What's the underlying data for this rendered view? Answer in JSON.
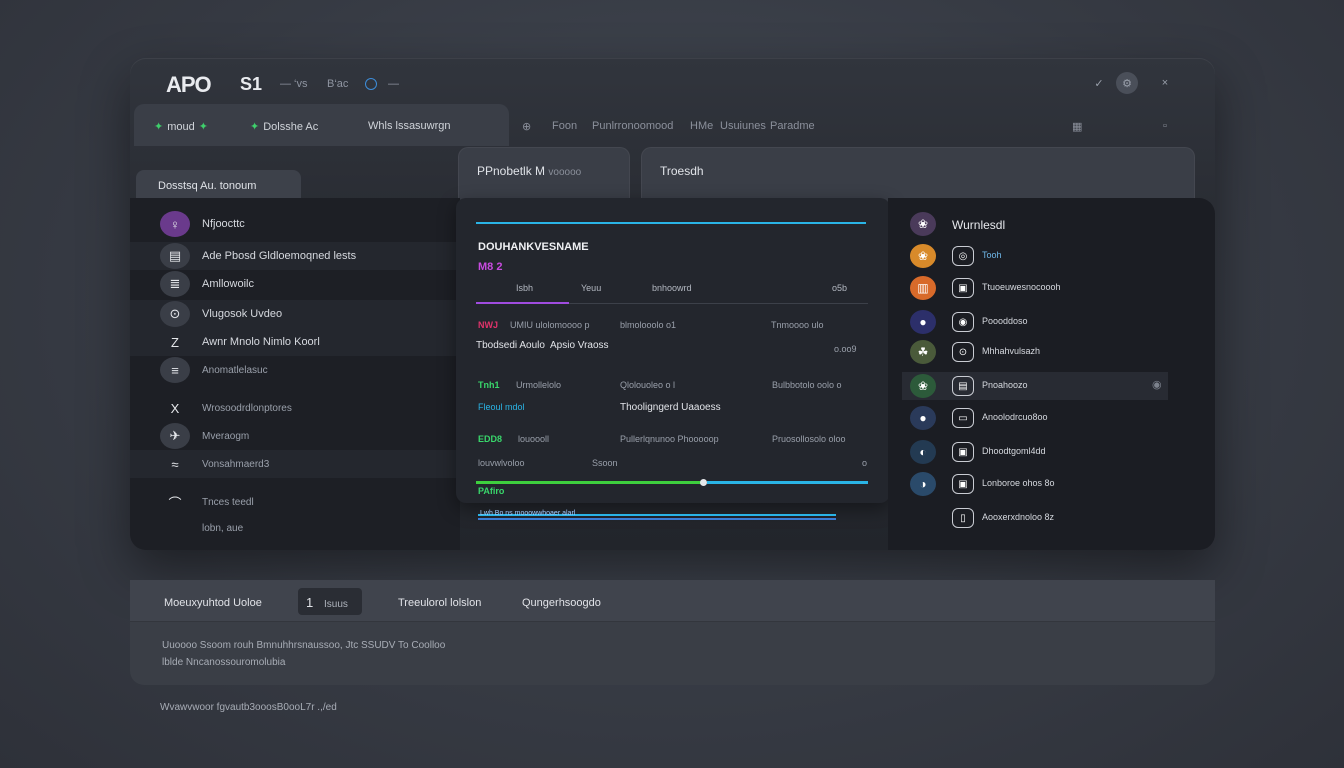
{
  "titlebar": {
    "logo": "APO",
    "app_title": "S1",
    "sub1": "— ‘vs",
    "sub2": "B‘ac",
    "sub3": "—"
  },
  "tabs": [
    {
      "label": "moud",
      "icon": "✦"
    },
    {
      "label": "Dolsshe Ac",
      "icon": "✦"
    },
    {
      "label": "Whls lssasuwrgn"
    }
  ],
  "toolbar": {
    "item1": "Foon",
    "item2": "Punlrronoomood",
    "item3": "HMe",
    "item4": "Usuiunes",
    "item5": "Paradme"
  },
  "tab_cards": {
    "card1": "PPnobetlk M",
    "card1_sub": "vooooo",
    "card2": "Troesdh"
  },
  "left_tab": "Dosstsq Au. tonoum",
  "left_items": [
    {
      "icon": "♀",
      "label": "Nfjoocttc"
    },
    {
      "icon": "▤",
      "label": "Ade Pbosd Gldloemoqned lests"
    },
    {
      "icon": "≣",
      "label": "Amllowoilc"
    },
    {
      "icon": "⊙",
      "label": "Vlugosok Uvdeo"
    },
    {
      "icon": "Z",
      "label": "Awnr Mnolo Nimlo Koorl"
    },
    {
      "icon": "≡",
      "label": "Anomatlelasuc"
    },
    {
      "icon": "X",
      "label": "Wrosoodrdlonptores"
    },
    {
      "icon": "✈",
      "label": "Mveraogm"
    },
    {
      "icon": "≈",
      "label": "Vonsahmaerd3"
    },
    {
      "icon": "⌒",
      "label": "Tnces teedl"
    },
    {
      "label": "lobn, aue"
    }
  ],
  "mid": {
    "title": "DOUHANKVESNAME",
    "subtitle": "M8 2",
    "tabs": [
      "Isbh",
      "Yeuu",
      "bnhoowrd",
      "o5b"
    ],
    "rows": [
      {
        "c1": "NWJ",
        "c1b": "UMIU ulolomoooo p",
        "c2": "blmolooolo o1",
        "c3": "Tnmoooo ulo"
      },
      {
        "c1": "Tbodsedi Aoulo",
        "c1b": "Apsio Vraoss",
        "c3": "o.oo9"
      },
      {
        "c1": "Tnh1",
        "c1b": "Urmollelolo",
        "c2": "Qlolouoleo o l",
        "c3": "Bulbbotolo oolo o"
      },
      {
        "c1": "Fleoul mdol",
        "c2": "Thooligngerd Uaaoess"
      },
      {
        "c1": "EDD8",
        "c1b": "louoooll",
        "c2": "Pullerlqnunoo Phooooop",
        "c3": "Pruosollosolo oloo"
      },
      {
        "c1": "louvwlvoloo",
        "c1b": "Ssoon",
        "c3": "o"
      }
    ],
    "progress_pct": 0.58,
    "green_label": "PAfiro",
    "wave_label": "Lwh Bo ns mooowwhoaer alarl"
  },
  "right": {
    "header": "Wurnlesdl",
    "items": [
      {
        "icon": "❀",
        "c": "#d88a2a",
        "icon2": "◎",
        "label": "Tooh"
      },
      {
        "icon": "▥",
        "c": "#d86a2a",
        "icon2": "▣",
        "label": "Ttuoeuwesnocoooh"
      },
      {
        "icon": "●",
        "c": "#2c2f6a",
        "icon2": "◉",
        "label": "Poooddoso"
      },
      {
        "icon": "☘",
        "c": "#4a5a3a",
        "icon2": "⊙",
        "label": "Mhhahvulsazh"
      },
      {
        "icon": "❀",
        "c": "#2c5a3a",
        "icon2": "▤",
        "label": "Pnoahoozo"
      },
      {
        "icon": "●",
        "c": "#2a3a5a",
        "icon2": "▭",
        "label": "Anoolodrcuo8oo"
      },
      {
        "icon": "◐",
        "c": "#233a52",
        "icon2": "▣",
        "label": "Dhoodtgoml4dd"
      },
      {
        "icon": "◑",
        "c": "#2a4a6a",
        "icon2": "▣",
        "label": "Lonboroe ohos 8o"
      },
      {
        "icon": "",
        "c": "transparent",
        "icon2": "▯",
        "label": "Aooxerxdnoloo 8z"
      }
    ]
  },
  "bottom": {
    "tab1": "Moeuxyuhtod Uoloe",
    "box_num": "1",
    "box_label": "Isuus",
    "tab2": "Treeulorol lolslon",
    "tab3": "Qungerhsoogdo",
    "line1": "Uuoooo Ssoom   rouh   Bmnuhhrsnaussoo, Jtc SSUDV   To Coolloo",
    "line2": "lblde Nncanossouromolubia"
  },
  "footer": "Wvawvwoor fgvautb3ooosB0ooL7r   .,/ed"
}
